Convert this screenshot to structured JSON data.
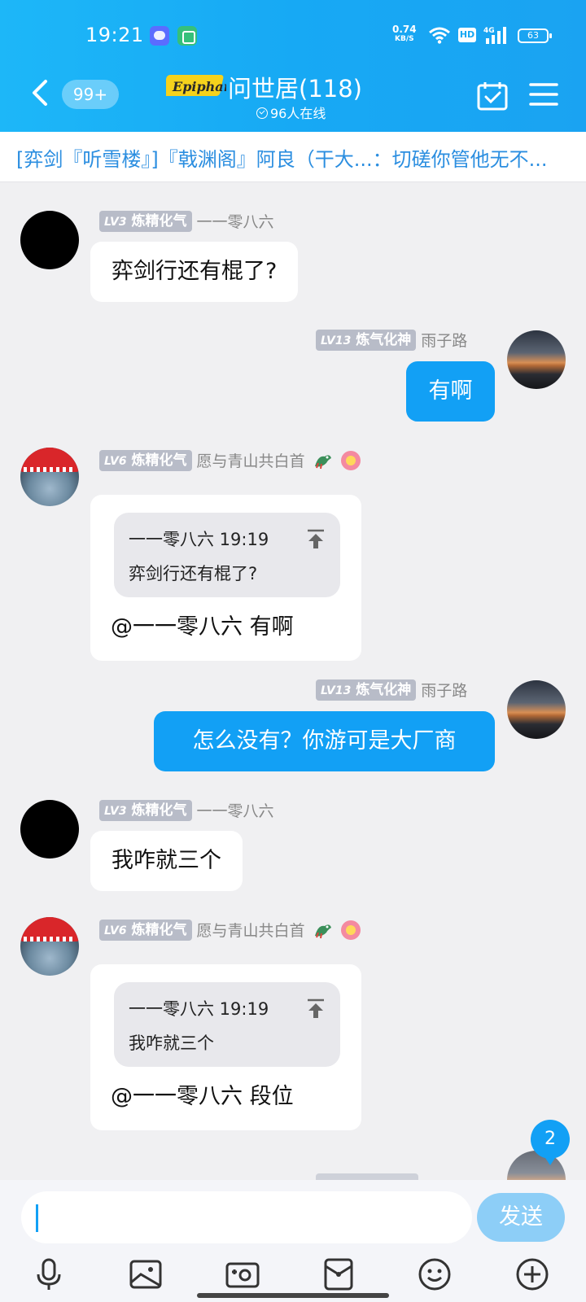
{
  "status": {
    "time": "19:21",
    "net_speed": "0.74",
    "net_unit": "KB/S",
    "hd": "HD",
    "signal": "4G",
    "battery": "63"
  },
  "nav": {
    "badge": "99+",
    "logo_text": "Epiphany",
    "title": "问世居(118)",
    "online": "96人在线"
  },
  "announcement": "[弈剑『听雪楼』]『戟渊阁』阿良（干大...：切磋你管他无不...",
  "messages": [
    {
      "lv": "LV3",
      "rank": "炼精化气",
      "nick": "一一零八六",
      "text": "弈剑行还有棍了?"
    },
    {
      "lv": "LV13",
      "rank": "炼气化神",
      "nick": "雨子路",
      "text": "有啊"
    },
    {
      "lv": "LV6",
      "rank": "炼精化气",
      "nick": "愿与青山共白首",
      "quote_head": "一一零八六 19:19",
      "quote_body": "弈剑行还有棍了?",
      "text": "@一一零八六 有啊"
    },
    {
      "lv": "LV13",
      "rank": "炼气化神",
      "nick": "雨子路",
      "text": "怎么没有？你游可是大厂商"
    },
    {
      "lv": "LV3",
      "rank": "炼精化气",
      "nick": "一一零八六",
      "text": "我咋就三个"
    },
    {
      "lv": "LV6",
      "rank": "炼精化气",
      "nick": "愿与青山共白首",
      "quote_head": "一一零八六 19:19",
      "quote_body": "我咋就三个",
      "text": "@一一零八六 段位"
    }
  ],
  "unread_count": "2",
  "composer": {
    "send_label": "发送"
  },
  "toolbar": [
    "mic-icon",
    "image-icon",
    "camera-icon",
    "red-packet-icon",
    "emoji-icon",
    "plus-icon"
  ],
  "colors": {
    "accent": "#12a0f5",
    "header": "#1aaaf4",
    "level_badge": "#b8bcc8"
  }
}
